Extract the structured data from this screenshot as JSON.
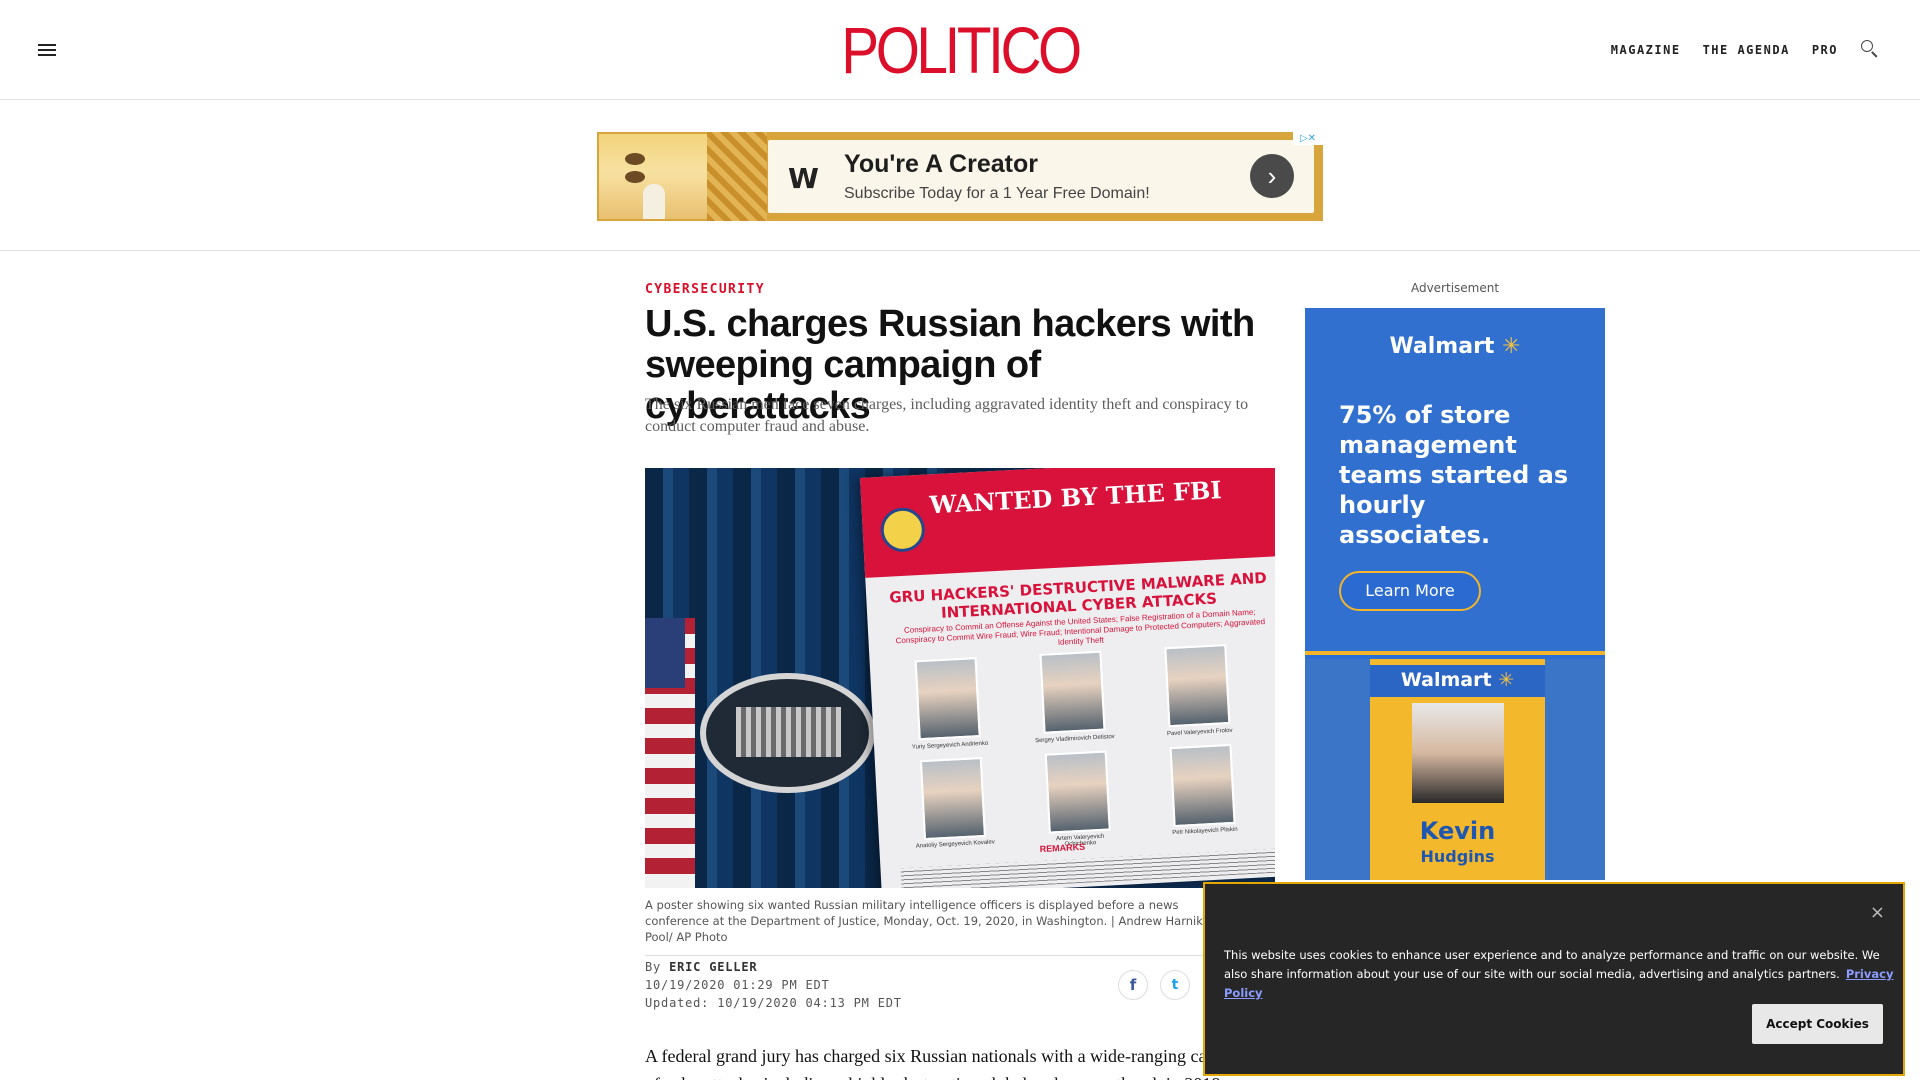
{
  "header": {
    "logo": "POLITICO",
    "nav": [
      "MAGAZINE",
      "THE AGENDA",
      "PRO"
    ]
  },
  "top_ad": {
    "title": "You're A Creator",
    "subtitle": "Subscribe Today for a 1 Year Free Domain!",
    "arrow": "›",
    "choices": "▷✕",
    "icon": "W"
  },
  "article": {
    "kicker": "CYBERSECURITY",
    "headline": "U.S. charges Russian hackers with sweeping campaign of cyberattacks",
    "dek": "The six Russian men face seven charges, including aggravated identity theft and conspiracy to conduct computer fraud and abuse.",
    "image": {
      "poster_title": "WANTED BY THE FBI",
      "poster_sub": "GRU HACKERS' DESTRUCTIVE MALWARE AND INTERNATIONAL CYBER ATTACKS",
      "poster_small": "Conspiracy to Commit an Offense Against the United States; False Registration of a Domain Name; Conspiracy to Commit Wire Fraud; Wire Fraud; Intentional Damage to Protected Computers; Aggravated Identity Theft",
      "poster_remarks": "REMARKS",
      "suspects": [
        "Yuriy Sergeyevich Andrienko",
        "Sergey Vladimirovich Detistov",
        "Pavel Valeryevich Frolov",
        "Anatoliy Sergeyevich Kovalev",
        "Artem Valeryevich Ochichenko",
        "Petr Nikolayevich Pliskin"
      ]
    },
    "caption": "A poster showing six wanted Russian military intelligence officers is displayed before a news conference at the Department of Justice, Monday, Oct. 19, 2020, in Washington. | Andrew Harnik, Pool/ AP Photo",
    "by_prefix": "By",
    "author": "ERIC GELLER",
    "published": "10/19/2020 01:29 PM EDT",
    "updated": "Updated: 10/19/2020 04:13 PM EDT",
    "share": {
      "facebook": "f",
      "twitter": "t"
    },
    "body": "A federal grand jury has charged six Russian nationals with a wide-ranging campaign of cyberattacks, including a highly destructive global malware outbreak in 2018..."
  },
  "rail_ad": {
    "label": "Advertisement",
    "brand": "Walmart",
    "spark": "✳",
    "headline": "75% of store management teams started as hourly associates.",
    "cta": "Learn More",
    "badge_first": "Kevin",
    "badge_last": "Hudgins"
  },
  "cookie": {
    "text": "This website uses cookies to enhance user experience and to analyze performance and traffic on our website. We also share information about your use of our site with our social media, advertising and analytics partners.",
    "link": "Privacy Policy",
    "accept": "Accept Cookies",
    "close": "×"
  },
  "colors": {
    "brand_red": "#dc0f2a",
    "walmart_blue": "#3170cf",
    "walmart_yellow": "#f2b42b",
    "cookie_bg": "#262626",
    "cookie_border": "#e4a600"
  }
}
